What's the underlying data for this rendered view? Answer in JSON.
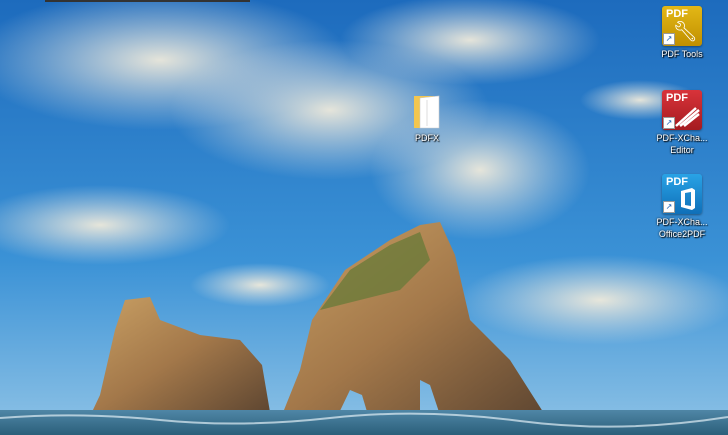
{
  "desktop": {
    "icons": [
      {
        "label": "PDFX",
        "type": "folder"
      },
      {
        "label": "PDF Tools",
        "type": "shortcut",
        "color": "#d4a300"
      },
      {
        "label": "PDF-XCha...",
        "label2": "Editor",
        "type": "shortcut",
        "color": "#c8262c"
      },
      {
        "label": "PDF-XCha...",
        "label2": "Office2PDF",
        "type": "shortcut",
        "color": "#1a8ad4"
      }
    ],
    "tile_text": "PDF"
  }
}
